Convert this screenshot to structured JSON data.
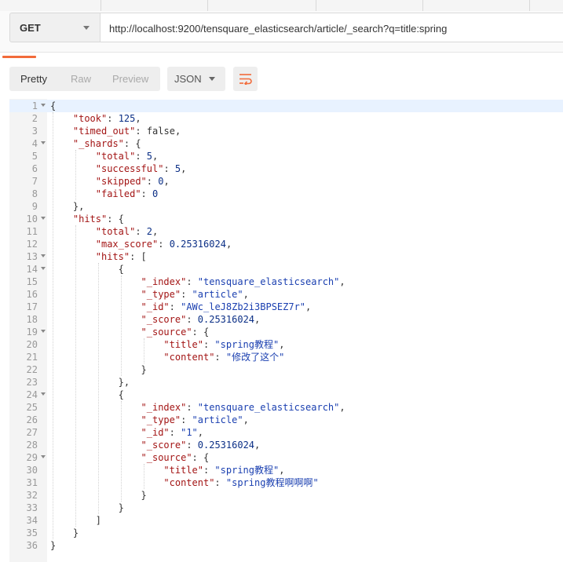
{
  "request": {
    "method": "GET",
    "url": "http://localhost:9200/tensquare_elasticsearch/article/_search?q=title:spring"
  },
  "response_toolbar": {
    "tabs": [
      "Pretty",
      "Raw",
      "Preview"
    ],
    "active_tab": "Pretty",
    "format": "JSON"
  },
  "colors": {
    "key": "#a31515",
    "string": "#1a3fb0",
    "number": "#0b2f86",
    "accent": "#f26b3a",
    "active_line": "#e8f2ff"
  },
  "body_lines": [
    {
      "n": "1",
      "indent": 0,
      "fold": true,
      "tokens": [
        [
          "p",
          "{"
        ]
      ]
    },
    {
      "n": "2",
      "indent": 1,
      "tokens": [
        [
          "k",
          "\"took\""
        ],
        [
          "p",
          ": "
        ],
        [
          "n",
          "125"
        ],
        [
          "p",
          ","
        ]
      ]
    },
    {
      "n": "3",
      "indent": 1,
      "tokens": [
        [
          "k",
          "\"timed_out\""
        ],
        [
          "p",
          ": "
        ],
        [
          "b",
          "false"
        ],
        [
          "p",
          ","
        ]
      ]
    },
    {
      "n": "4",
      "indent": 1,
      "fold": true,
      "tokens": [
        [
          "k",
          "\"_shards\""
        ],
        [
          "p",
          ": {"
        ]
      ]
    },
    {
      "n": "5",
      "indent": 2,
      "tokens": [
        [
          "k",
          "\"total\""
        ],
        [
          "p",
          ": "
        ],
        [
          "n",
          "5"
        ],
        [
          "p",
          ","
        ]
      ]
    },
    {
      "n": "6",
      "indent": 2,
      "tokens": [
        [
          "k",
          "\"successful\""
        ],
        [
          "p",
          ": "
        ],
        [
          "n",
          "5"
        ],
        [
          "p",
          ","
        ]
      ]
    },
    {
      "n": "7",
      "indent": 2,
      "tokens": [
        [
          "k",
          "\"skipped\""
        ],
        [
          "p",
          ": "
        ],
        [
          "n",
          "0"
        ],
        [
          "p",
          ","
        ]
      ]
    },
    {
      "n": "8",
      "indent": 2,
      "tokens": [
        [
          "k",
          "\"failed\""
        ],
        [
          "p",
          ": "
        ],
        [
          "n",
          "0"
        ]
      ]
    },
    {
      "n": "9",
      "indent": 1,
      "tokens": [
        [
          "p",
          "},"
        ]
      ]
    },
    {
      "n": "10",
      "indent": 1,
      "fold": true,
      "tokens": [
        [
          "k",
          "\"hits\""
        ],
        [
          "p",
          ": {"
        ]
      ]
    },
    {
      "n": "11",
      "indent": 2,
      "tokens": [
        [
          "k",
          "\"total\""
        ],
        [
          "p",
          ": "
        ],
        [
          "n",
          "2"
        ],
        [
          "p",
          ","
        ]
      ]
    },
    {
      "n": "12",
      "indent": 2,
      "tokens": [
        [
          "k",
          "\"max_score\""
        ],
        [
          "p",
          ": "
        ],
        [
          "n",
          "0.25316024"
        ],
        [
          "p",
          ","
        ]
      ]
    },
    {
      "n": "13",
      "indent": 2,
      "fold": true,
      "tokens": [
        [
          "k",
          "\"hits\""
        ],
        [
          "p",
          ": ["
        ]
      ]
    },
    {
      "n": "14",
      "indent": 3,
      "fold": true,
      "tokens": [
        [
          "p",
          "{"
        ]
      ]
    },
    {
      "n": "15",
      "indent": 4,
      "tokens": [
        [
          "k",
          "\"_index\""
        ],
        [
          "p",
          ": "
        ],
        [
          "s",
          "\"tensquare_elasticsearch\""
        ],
        [
          "p",
          ","
        ]
      ]
    },
    {
      "n": "16",
      "indent": 4,
      "tokens": [
        [
          "k",
          "\"_type\""
        ],
        [
          "p",
          ": "
        ],
        [
          "s",
          "\"article\""
        ],
        [
          "p",
          ","
        ]
      ]
    },
    {
      "n": "17",
      "indent": 4,
      "tokens": [
        [
          "k",
          "\"_id\""
        ],
        [
          "p",
          ": "
        ],
        [
          "s",
          "\"AWc_leJ8Zb2i3BPSEZ7r\""
        ],
        [
          "p",
          ","
        ]
      ]
    },
    {
      "n": "18",
      "indent": 4,
      "tokens": [
        [
          "k",
          "\"_score\""
        ],
        [
          "p",
          ": "
        ],
        [
          "n",
          "0.25316024"
        ],
        [
          "p",
          ","
        ]
      ]
    },
    {
      "n": "19",
      "indent": 4,
      "fold": true,
      "tokens": [
        [
          "k",
          "\"_source\""
        ],
        [
          "p",
          ": {"
        ]
      ]
    },
    {
      "n": "20",
      "indent": 5,
      "tokens": [
        [
          "k",
          "\"title\""
        ],
        [
          "p",
          ": "
        ],
        [
          "s",
          "\"spring教程\""
        ],
        [
          "p",
          ","
        ]
      ]
    },
    {
      "n": "21",
      "indent": 5,
      "tokens": [
        [
          "k",
          "\"content\""
        ],
        [
          "p",
          ": "
        ],
        [
          "s",
          "\"修改了这个\""
        ]
      ]
    },
    {
      "n": "22",
      "indent": 4,
      "tokens": [
        [
          "p",
          "}"
        ]
      ]
    },
    {
      "n": "23",
      "indent": 3,
      "tokens": [
        [
          "p",
          "},"
        ]
      ]
    },
    {
      "n": "24",
      "indent": 3,
      "fold": true,
      "tokens": [
        [
          "p",
          "{"
        ]
      ]
    },
    {
      "n": "25",
      "indent": 4,
      "tokens": [
        [
          "k",
          "\"_index\""
        ],
        [
          "p",
          ": "
        ],
        [
          "s",
          "\"tensquare_elasticsearch\""
        ],
        [
          "p",
          ","
        ]
      ]
    },
    {
      "n": "26",
      "indent": 4,
      "tokens": [
        [
          "k",
          "\"_type\""
        ],
        [
          "p",
          ": "
        ],
        [
          "s",
          "\"article\""
        ],
        [
          "p",
          ","
        ]
      ]
    },
    {
      "n": "27",
      "indent": 4,
      "tokens": [
        [
          "k",
          "\"_id\""
        ],
        [
          "p",
          ": "
        ],
        [
          "s",
          "\"1\""
        ],
        [
          "p",
          ","
        ]
      ]
    },
    {
      "n": "28",
      "indent": 4,
      "tokens": [
        [
          "k",
          "\"_score\""
        ],
        [
          "p",
          ": "
        ],
        [
          "n",
          "0.25316024"
        ],
        [
          "p",
          ","
        ]
      ]
    },
    {
      "n": "29",
      "indent": 4,
      "fold": true,
      "tokens": [
        [
          "k",
          "\"_source\""
        ],
        [
          "p",
          ": {"
        ]
      ]
    },
    {
      "n": "30",
      "indent": 5,
      "tokens": [
        [
          "k",
          "\"title\""
        ],
        [
          "p",
          ": "
        ],
        [
          "s",
          "\"spring教程\""
        ],
        [
          "p",
          ","
        ]
      ]
    },
    {
      "n": "31",
      "indent": 5,
      "tokens": [
        [
          "k",
          "\"content\""
        ],
        [
          "p",
          ": "
        ],
        [
          "s",
          "\"spring教程啊啊啊\""
        ]
      ]
    },
    {
      "n": "32",
      "indent": 4,
      "tokens": [
        [
          "p",
          "}"
        ]
      ]
    },
    {
      "n": "33",
      "indent": 3,
      "tokens": [
        [
          "p",
          "}"
        ]
      ]
    },
    {
      "n": "34",
      "indent": 2,
      "tokens": [
        [
          "p",
          "]"
        ]
      ]
    },
    {
      "n": "35",
      "indent": 1,
      "tokens": [
        [
          "p",
          "}"
        ]
      ]
    },
    {
      "n": "36",
      "indent": 0,
      "tokens": [
        [
          "p",
          "}"
        ]
      ]
    }
  ]
}
